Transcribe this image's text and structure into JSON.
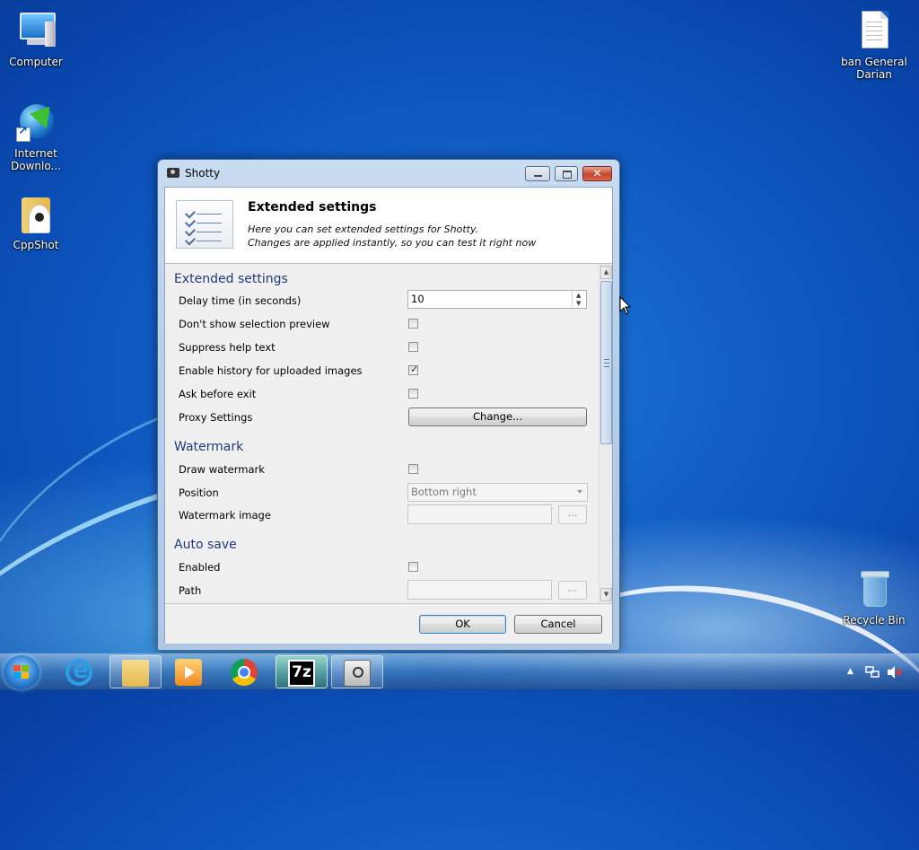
{
  "desktop": {
    "icons_left": [
      {
        "label": "Computer"
      },
      {
        "label": "Internet Downlo..."
      },
      {
        "label": "CppShot"
      }
    ],
    "icons_right": [
      {
        "label_line1": "ban General",
        "label_line2": "Darian"
      },
      {
        "label": "Recycle Bin"
      }
    ]
  },
  "window": {
    "title": "Shotty",
    "header": {
      "title": "Extended settings",
      "desc_line1": "Here you can set extended settings for Shotty.",
      "desc_line2": "Changes are applied instantly, so you can test it right now"
    },
    "sections": {
      "extended": {
        "heading": "Extended settings",
        "delay_label": "Delay time (in seconds)",
        "delay_value": "10",
        "no_preview_label": "Don't show selection preview",
        "no_preview_checked": false,
        "suppress_help_label": "Suppress help text",
        "suppress_help_checked": false,
        "history_label": "Enable history for uploaded images",
        "history_checked": true,
        "ask_exit_label": "Ask before exit",
        "ask_exit_checked": false,
        "proxy_label": "Proxy Settings",
        "proxy_button": "Change..."
      },
      "watermark": {
        "heading": "Watermark",
        "draw_label": "Draw watermark",
        "draw_checked": false,
        "position_label": "Position",
        "position_value": "Bottom right",
        "image_label": "Watermark image",
        "browse_button": "..."
      },
      "autosave": {
        "heading": "Auto save",
        "enabled_label": "Enabled",
        "enabled_checked": false,
        "path_label": "Path",
        "browse_button": "..."
      }
    },
    "footer": {
      "ok": "OK",
      "cancel": "Cancel"
    }
  },
  "taskbar": {
    "items": [
      {
        "icon": "internet-explorer-icon"
      },
      {
        "icon": "windows-explorer-icon"
      },
      {
        "icon": "media-player-icon"
      },
      {
        "icon": "chrome-icon"
      },
      {
        "icon": "7zip-icon",
        "text": "7z"
      },
      {
        "icon": "shotty-camera-icon"
      }
    ]
  },
  "tray": {
    "show_hidden": "▲",
    "network": "network-icon",
    "volume": "volume-muted-icon"
  }
}
